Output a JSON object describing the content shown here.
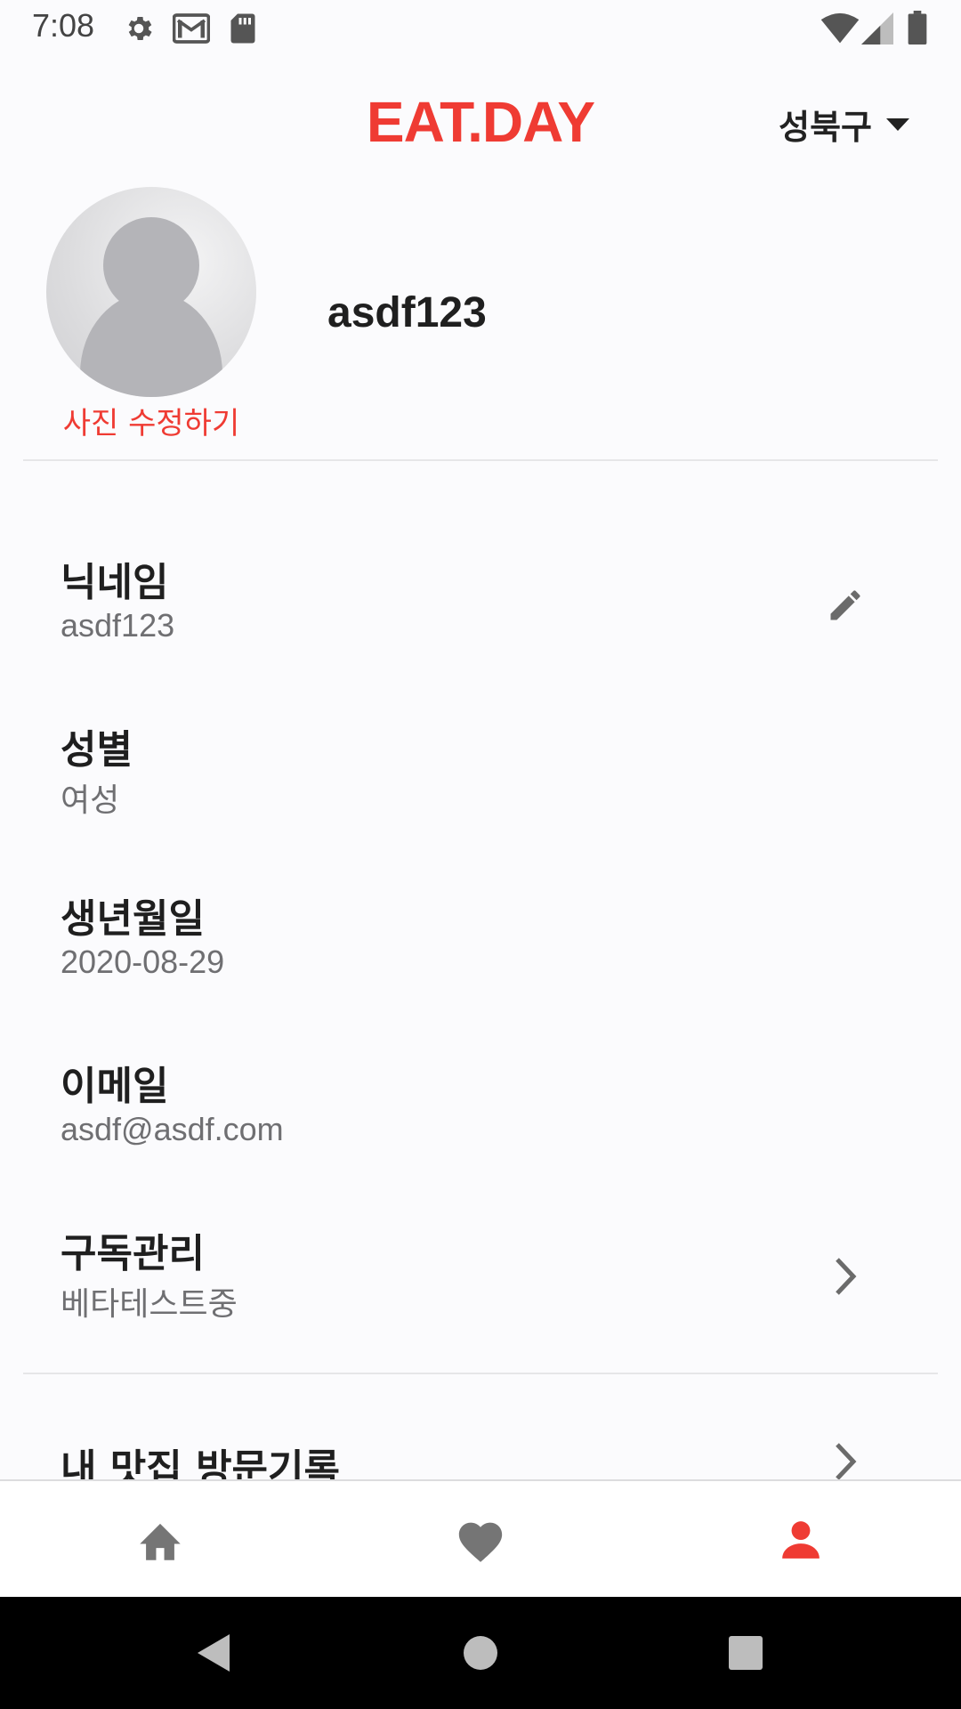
{
  "status_bar": {
    "time": "7:08",
    "icons": [
      "settings-gear-icon",
      "gmail-icon",
      "sd-card-icon",
      "wifi-icon",
      "cell-signal-icon",
      "battery-icon"
    ]
  },
  "header": {
    "brand": "EAT.DAY",
    "district": "성북구",
    "district_dropdown_icon": "caret-down-icon"
  },
  "profile": {
    "avatar_icon": "default-avatar-icon",
    "edit_photo_label": "사진 수정하기",
    "username": "asdf123"
  },
  "fields": [
    {
      "label": "닉네임",
      "value": "asdf123",
      "action_icon": "pencil-edit-icon"
    },
    {
      "label": "성별",
      "value": "여성"
    },
    {
      "label": "생년월일",
      "value": "2020-08-29"
    },
    {
      "label": "이메일",
      "value": "asdf@asdf.com"
    },
    {
      "label": "구독관리",
      "value": "베타테스트중",
      "action_icon": "chevron-right-icon"
    }
  ],
  "visit_history": {
    "label": "내 맛집 방문기록",
    "action_icon": "chevron-right-icon"
  },
  "bottom_nav": {
    "tabs": [
      {
        "name": "home",
        "icon": "home-icon",
        "active": false
      },
      {
        "name": "favorites",
        "icon": "heart-icon",
        "active": false
      },
      {
        "name": "profile",
        "icon": "person-icon",
        "active": true
      }
    ]
  },
  "system_nav": {
    "icons": [
      "back-icon",
      "home-circle-icon",
      "recents-icon"
    ]
  },
  "colors": {
    "accent": "#ef3b33",
    "inactive_icon": "#757575",
    "label": "#1f1f1f",
    "value": "#6f6f72",
    "background": "#fbfbfd"
  }
}
